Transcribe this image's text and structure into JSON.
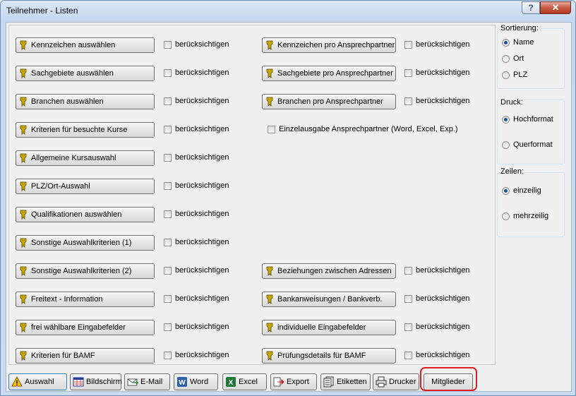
{
  "window": {
    "title": "Teilnehmer - Listen",
    "help_glyph": "?",
    "close_glyph": "✕"
  },
  "left_rows": [
    {
      "label": "Kennzeichen auswählen",
      "check": "berücksichtigen"
    },
    {
      "label": "Sachgebiete auswählen",
      "check": "berücksichtigen"
    },
    {
      "label": "Branchen auswählen",
      "check": "berücksichtigen"
    },
    {
      "label": "Kriterien für besuchte Kurse",
      "check": "berücksichtigen"
    },
    {
      "label": "Allgemeine Kursauswahl",
      "check": "berücksichtigen"
    },
    {
      "label": "PLZ/Ort-Auswahl",
      "check": "berücksichtigen"
    },
    {
      "label": "Qualifikationen auswählen",
      "check": "berücksichtigen"
    },
    {
      "label": "Sonstige Auswahlkriterien (1)",
      "check": "berücksichtigen"
    },
    {
      "label": "Sonstige Auswahlkriterien (2)",
      "check": "berücksichtigen"
    },
    {
      "label": "Freitext - Information",
      "check": "berücksichtigen"
    },
    {
      "label": "frei wählbare Eingabefelder",
      "check": "berücksichtigen"
    },
    {
      "label": "Kriterien für BAMF",
      "check": "berücksichtigen"
    }
  ],
  "right_rows": {
    "r0": {
      "label": "Kennzeichen pro Ansprechpartner",
      "check": "berücksichtigen"
    },
    "r1": {
      "label": "Sachgebiete pro Ansprechpartner",
      "check": "berücksichtigen"
    },
    "r2": {
      "label": "Branchen pro Ansprechpartner",
      "check": "berücksichtigen"
    },
    "einzel": "Einzelausgabe Ansprechpartner (Word, Excel, Exp.)",
    "r8": {
      "label": "Beziehungen zwischen Adressen",
      "check": "berücksichtigen"
    },
    "r9": {
      "label": "Bankanweisungen / Bankverb.",
      "check": "berücksichtigen"
    },
    "r10": {
      "label": "individuelle Eingabefelder",
      "check": "berücksichtigen"
    },
    "r11": {
      "label": "Prüfungsdetails für BAMF",
      "check": "berücksichtigen"
    }
  },
  "sortierung": {
    "label": "Sortierung:",
    "options": [
      "Name",
      "Ort",
      "PLZ"
    ],
    "selected": "Name"
  },
  "druck": {
    "label": "Druck:",
    "options": [
      "Hochformat",
      "Querformat"
    ],
    "selected": "Hochformat"
  },
  "zeilen": {
    "label": "Zeilen:",
    "options": [
      "einzeilig",
      "mehrzeilig"
    ],
    "selected": "einzeilig"
  },
  "toolbar": {
    "auswahl": "Auswahl",
    "bildschirm": "Bildschirm",
    "email": "E-Mail",
    "word": "Word",
    "excel": "Excel",
    "export": "Export",
    "etiketten": "Etiketten",
    "drucker": "Drucker",
    "mitglieder": "Mitglieder"
  },
  "colors": {
    "highlight": "#e02020",
    "pen_icon": "#c9a400",
    "title_bar": "#c5d8ee"
  }
}
